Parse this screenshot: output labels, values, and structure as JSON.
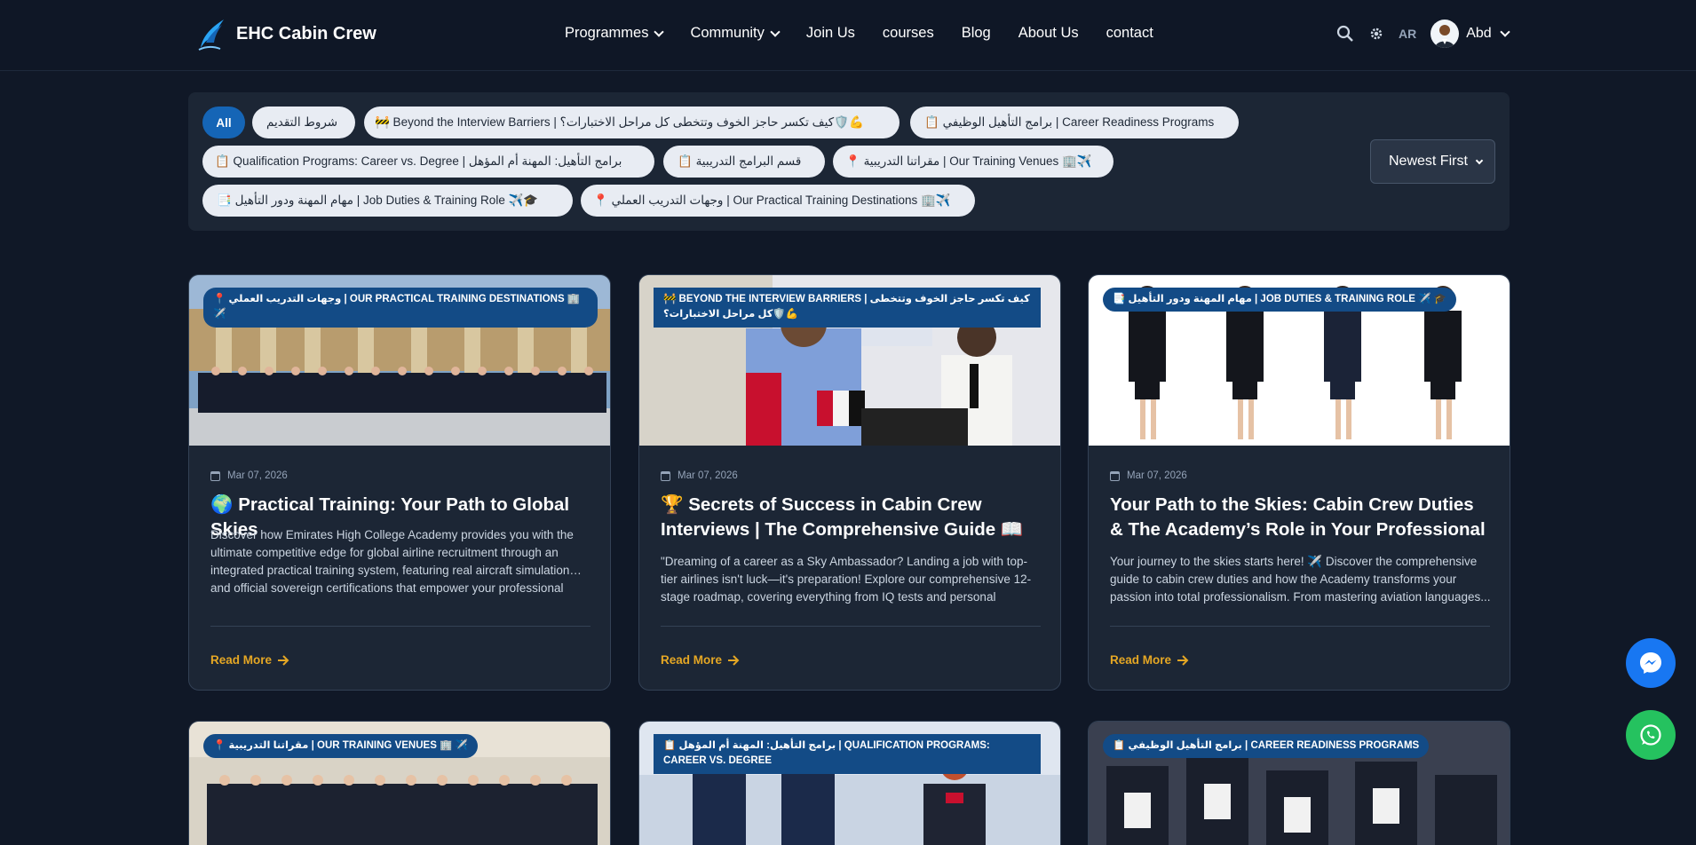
{
  "brand": {
    "name": "EHC Cabin Crew"
  },
  "nav": {
    "items": [
      {
        "label": "Programmes",
        "dropdown": true
      },
      {
        "label": "Community",
        "dropdown": true
      },
      {
        "label": "Join Us",
        "dropdown": false
      },
      {
        "label": "courses",
        "dropdown": false
      },
      {
        "label": "Blog",
        "dropdown": false
      },
      {
        "label": "About Us",
        "dropdown": false
      },
      {
        "label": "contact",
        "dropdown": false
      }
    ],
    "lang": "AR",
    "user": "Abd"
  },
  "filters": {
    "chips": [
      {
        "label": "All",
        "active": true
      },
      {
        "label": "شروط التقديم"
      },
      {
        "label": "🚧 Beyond the Interview Barriers | كيف تكسر حاجز الخوف وتتخطى كل مراحل الاختبارات؟🛡️💪"
      },
      {
        "label": "📋 برامج التأهيل الوظيفي | Career Readiness Programs"
      },
      {
        "label": "📋 Qualification Programs: Career vs. Degree | برامج التأهيل: المهنة أم المؤهل"
      },
      {
        "label": "📋 قسم البرامج التدريبية"
      },
      {
        "label": "📍 مقراتنا التدريبية | Our Training Venues 🏢✈️"
      },
      {
        "label": "📑 مهام المهنة ودور التأهيل | Job Duties & Training Role ✈️🎓"
      },
      {
        "label": "📍 وجهات التدريب العملي | Our Practical Training Destinations 🏢✈️"
      }
    ],
    "sort": "Newest First"
  },
  "cards": [
    {
      "tag": "📍 وجهات التدريب العملي | OUR PRACTICAL TRAINING DESTINATIONS 🏢 ✈️",
      "date": "Mar 07, 2026",
      "title": "🌍 Practical Training: Your Path to Global Skies",
      "excerpt": "Discover how Emirates High College Academy provides you with the ultimate competitive edge for global airline recruitment through an integrated practical training system, featuring real aircraft simulation… and official sovereign certifications that empower your professional",
      "read_more": "Read More"
    },
    {
      "tag": "🚧 BEYOND THE INTERVIEW BARRIERS | كيف تكسر حاجز الخوف وتتخطى كل مراحل الاختبارات؟🛡️💪",
      "date": "Mar 07, 2026",
      "title": "🏆 Secrets of Success in Cabin Crew Interviews | The Comprehensive Guide 📖 🚀 Fly with...",
      "excerpt": "\"Dreaming of a career as a Sky Ambassador? Landing a job with top-tier airlines isn't luck—it's preparation! Explore our comprehensive 12-stage roadmap, covering everything from IQ tests and personal interviews to...",
      "read_more": "Read More"
    },
    {
      "tag": "📑 مهام المهنة ودور التأهيل | JOB DUTIES & TRAINING ROLE ✈️ 🎓",
      "date": "Mar 07, 2026",
      "title": "Your Path to the Skies: Cabin Crew Duties & The Academy’s Role in Your Professional Success ...",
      "excerpt": "Your journey to the skies starts here! ✈️ Discover the comprehensive guide to cabin crew duties and how the Academy transforms your passion into total professionalism. From mastering aviation languages...",
      "read_more": "Read More"
    },
    {
      "tag": "📍 مقراتنا التدريبية | OUR TRAINING VENUES 🏢 ✈️"
    },
    {
      "tag": "📋 برامج التأهيل: المهنة أم المؤهل | QUALIFICATION PROGRAMS: CAREER VS. DEGREE"
    },
    {
      "tag": "📋 برامج التأهيل الوظيفي | CAREER READINESS PROGRAMS"
    }
  ],
  "colors": {
    "accent": "#1565b6",
    "read_more": "#e5a724",
    "background": "#101827",
    "card": "#1c2635"
  },
  "icons": [
    "search-icon",
    "gear-icon",
    "chevron-down-icon",
    "calendar-icon",
    "arrow-right-icon",
    "messenger-icon",
    "whatsapp-icon"
  ]
}
